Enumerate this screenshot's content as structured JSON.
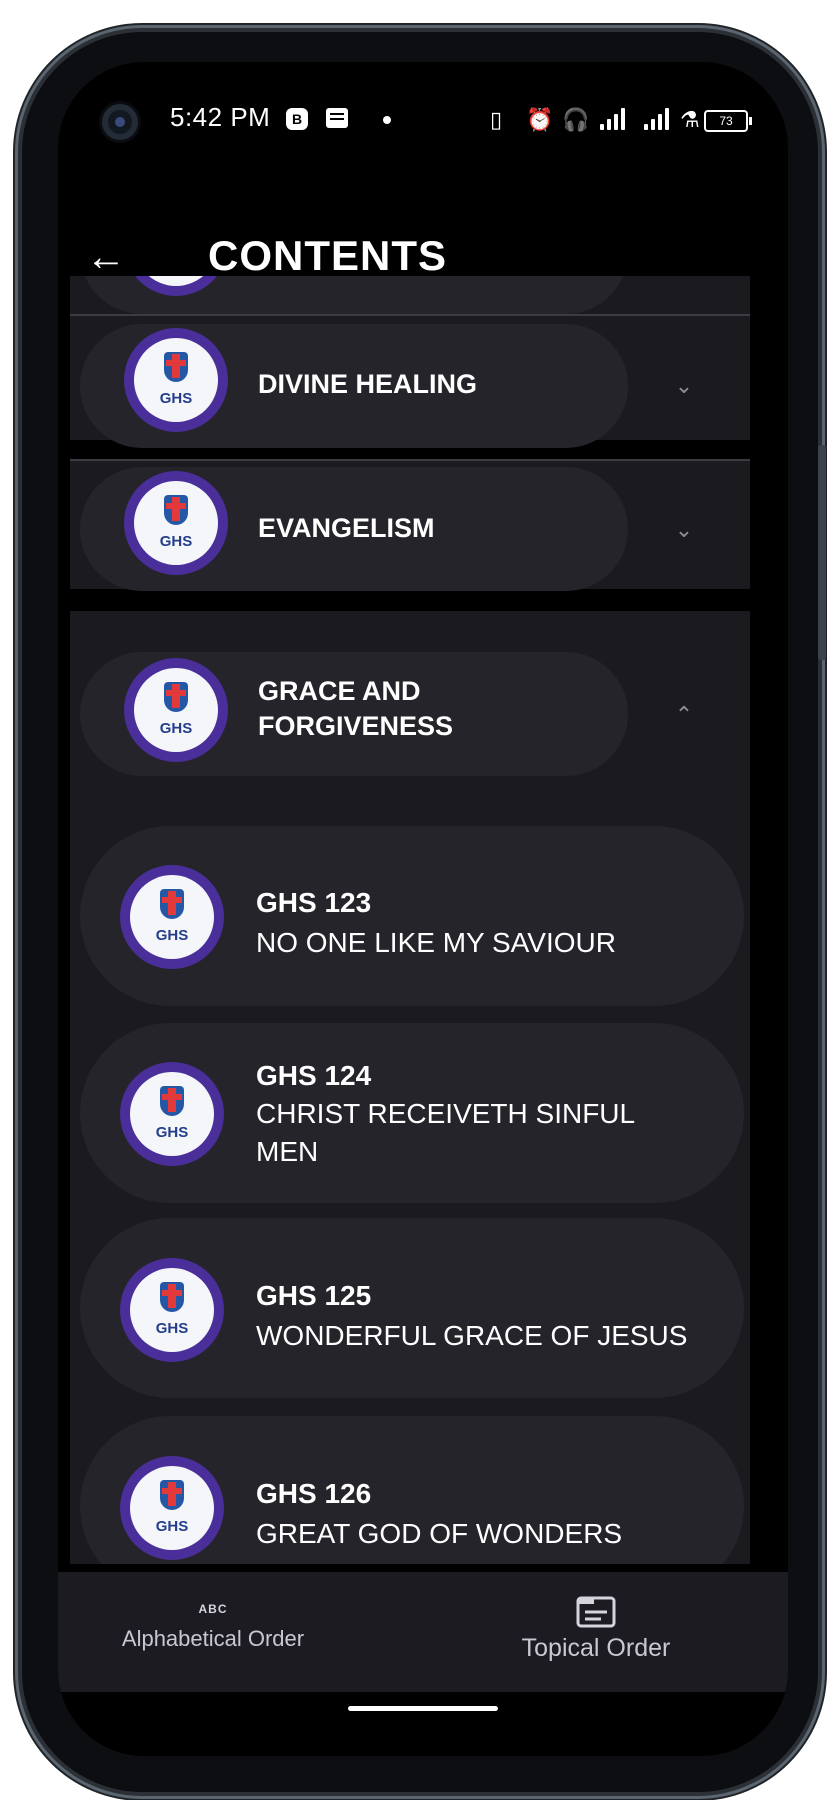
{
  "status_bar": {
    "time": "5:42 PM",
    "icons": [
      "b-badge-icon",
      "message-icon",
      "dot-icon",
      "vibrate-icon",
      "alarm-icon",
      "headphones-icon",
      "signal-icon",
      "signal-icon",
      "lab-icon"
    ],
    "battery": "73"
  },
  "header": {
    "title": "CONTENTS",
    "back_icon": "arrow-left-icon"
  },
  "categories": [
    {
      "label": "DIVINE HEALING",
      "expanded": false
    },
    {
      "label": "EVANGELISM",
      "expanded": false
    },
    {
      "label_line1": "GRACE AND",
      "label_line2": "FORGIVENESS",
      "expanded": true
    }
  ],
  "songs": [
    {
      "number": "GHS 123",
      "title": "NO ONE LIKE MY SAVIOUR"
    },
    {
      "number": "GHS 124",
      "title_line1": "CHRIST RECEIVETH SINFUL",
      "title_line2": "MEN"
    },
    {
      "number": "GHS 125",
      "title": "WONDERFUL GRACE OF JESUS"
    },
    {
      "number": "GHS 126",
      "title": "GREAT GOD OF WONDERS"
    }
  ],
  "logo_text": "GHS",
  "bottom_nav": {
    "items": [
      {
        "label": "Alphabetical Order",
        "icon": "abc-icon",
        "icon_text": "ABC",
        "active": false
      },
      {
        "label": "Topical Order",
        "icon": "document-icon",
        "active": true
      }
    ]
  },
  "colors": {
    "background": "#000000",
    "card": "#25242a",
    "section": "#1b1a1f",
    "logo_ring": "#4a2f9a"
  }
}
